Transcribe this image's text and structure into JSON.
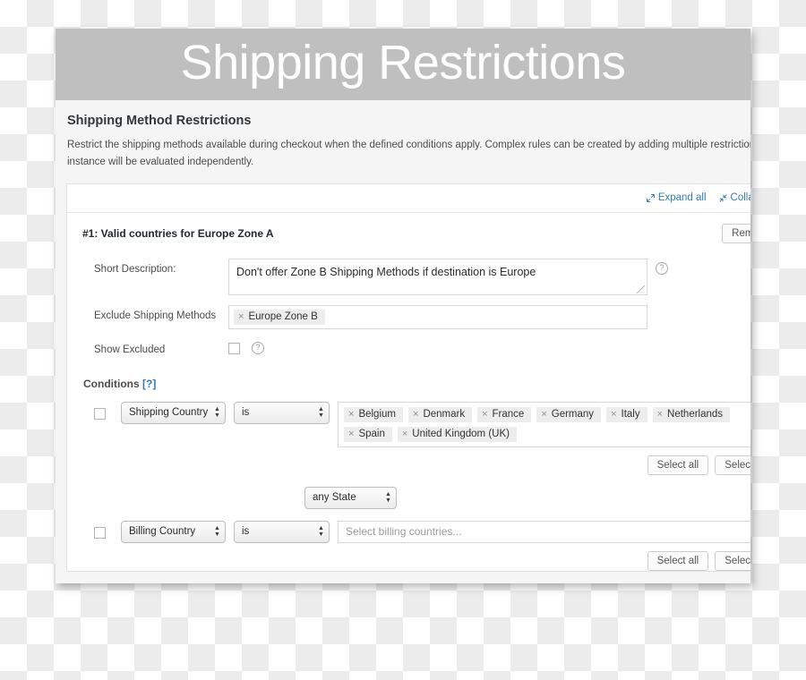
{
  "banner": {
    "title": "Shipping Restrictions"
  },
  "section": {
    "title": "Shipping Method Restrictions",
    "description": "Restrict the shipping methods available during checkout when the defined conditions apply. Complex rules can be created by adding multiple restriction instances. Each instance will be evaluated independently."
  },
  "toolbar": {
    "expand_all": "Expand all",
    "collapse_all": "Collapse all",
    "expand_icon": "expand-arrows-icon",
    "collapse_icon": "collapse-arrows-icon"
  },
  "restriction": {
    "title": "#1: Valid countries for Europe Zone A",
    "remove_label": "Remove",
    "fields": {
      "short_description_label": "Short Description:",
      "short_description_value": "Don't offer Zone B Shipping Methods if destination is Europe",
      "exclude_methods_label": "Exclude Shipping Methods",
      "exclude_methods_tokens": [
        "Europe Zone B"
      ],
      "show_excluded_label": "Show Excluded",
      "show_excluded_checked": false,
      "help_icon": "question-mark-circle-icon"
    }
  },
  "conditions": {
    "heading": "Conditions",
    "help_marker": "[?]",
    "rows": [
      {
        "checked": false,
        "field": "Shipping Country",
        "operator": "is",
        "tokens": [
          "Belgium",
          "Denmark",
          "France",
          "Germany",
          "Italy",
          "Netherlands",
          "Spain",
          "United Kingdom (UK)"
        ],
        "select_all": "Select all",
        "select_none": "Select none"
      },
      {
        "state_select": "any State"
      },
      {
        "checked": false,
        "field": "Billing Country",
        "operator": "is",
        "placeholder": "Select billing countries...",
        "select_all": "Select all",
        "select_none": "Select none"
      }
    ]
  },
  "icons": {
    "token_remove": "×",
    "caret_up": "▲",
    "caret_down": "▼"
  }
}
